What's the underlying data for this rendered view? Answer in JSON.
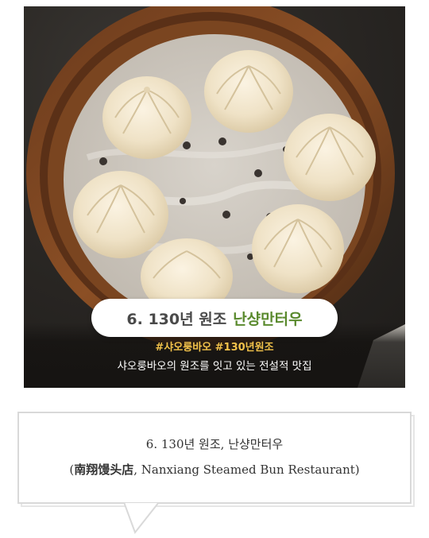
{
  "image": {
    "subject": "xiaolongbao-in-bamboo-steamer",
    "pill": {
      "number_prefix": "6. 130년 원조",
      "name": "난샹만터우"
    },
    "hashtags": "#샤오룽바오 #130년원조",
    "subtitle": "샤오룽바오의 원조를 잇고 있는 전설적 맛집",
    "colors": {
      "pill_name": "#5a8a2e",
      "hashtags": "#f2c24a"
    }
  },
  "caption": {
    "line1": "6. 130년 원조, 난샹만터우",
    "line2_open": "(",
    "line2_chinese": "南翔馒头店",
    "line2_rest": ", Nanxiang Steamed Bun Restaurant)"
  }
}
